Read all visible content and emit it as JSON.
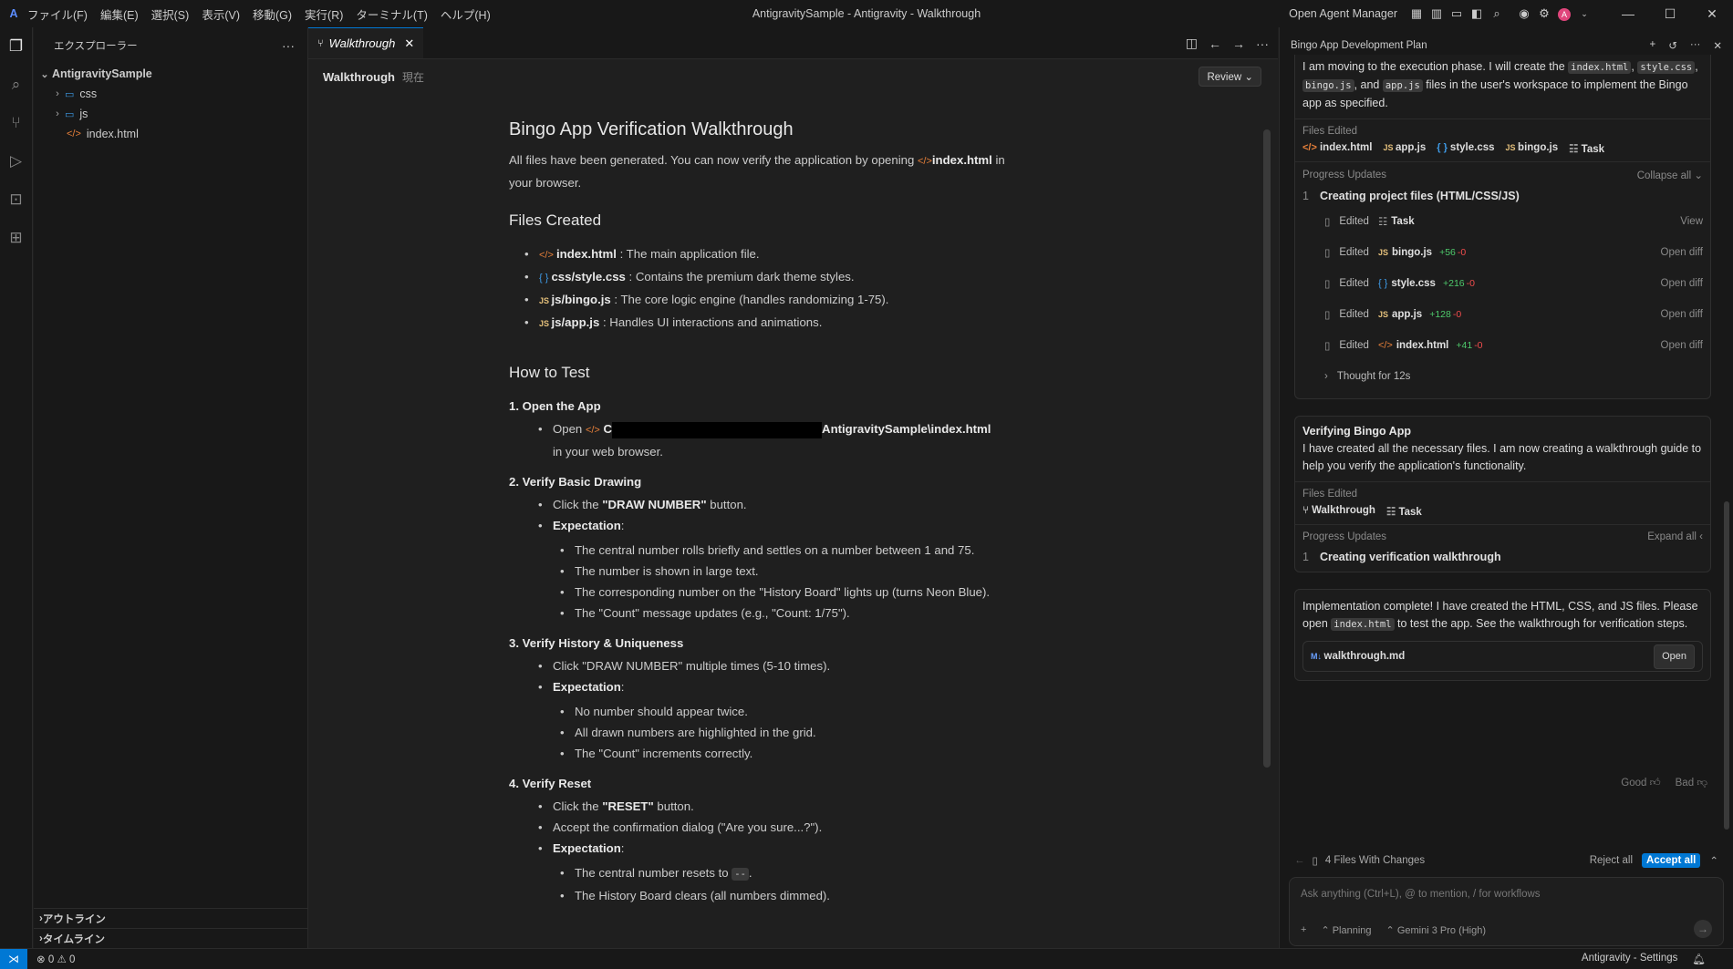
{
  "menu": [
    "ファイル(F)",
    "編集(E)",
    "選択(S)",
    "表示(V)",
    "移動(G)",
    "実行(R)",
    "ターミナル(T)",
    "ヘルプ(H)"
  ],
  "window_title": "AntigravitySample - Antigravity - Walkthrough",
  "open_agent_manager": "Open Agent Manager",
  "explorer": {
    "title": "エクスプローラー",
    "root": "AntigravitySample",
    "folders": [
      "css",
      "js"
    ],
    "file": "index.html",
    "outline": "アウトライン",
    "timeline": "タイムライン"
  },
  "tab": {
    "label": "Walkthrough"
  },
  "breadcrumb": {
    "name": "Walkthrough",
    "tag": "現在",
    "review": "Review"
  },
  "doc": {
    "title": "Bingo App Verification Walkthrough",
    "intro_a": "All files have been generated. You can now verify the application by opening",
    "intro_file": "index.html",
    "intro_b": "in",
    "intro_c": "your browser.",
    "files_heading": "Files Created",
    "files": [
      {
        "name": "index.html",
        "desc": ": The main application file."
      },
      {
        "name": "css/style.css",
        "desc": ": Contains the premium dark theme styles."
      },
      {
        "name": "js/bingo.js",
        "desc": ": The core logic engine (handles randomizing 1-75)."
      },
      {
        "name": "js/app.js",
        "desc": ": Handles UI interactions and animations."
      }
    ],
    "test_heading": "How to Test",
    "s1": "1. Open the App",
    "s1_open": "Open",
    "s1_c": "C",
    "s1_path": "AntigravitySample\\index.html",
    "s1_tail": "in your web browser.",
    "s2": "2. Verify Basic Drawing",
    "s2_click": "Click the",
    "s2_btn": "\"DRAW NUMBER\"",
    "s2_button": "button.",
    "expectation": "Expectation",
    "s2_exp": [
      "The central number rolls briefly and settles on a number between 1 and 75.",
      "The number is shown in large text.",
      "The corresponding number on the \"History Board\" lights up (turns Neon Blue).",
      "The \"Count\" message updates (e.g., \"Count: 1/75\")."
    ],
    "s3": "3. Verify History & Uniqueness",
    "s3_click": "Click \"DRAW NUMBER\" multiple times (5-10 times).",
    "s3_exp": [
      "No number should appear twice.",
      "All drawn numbers are highlighted in the grid.",
      "The \"Count\" increments correctly."
    ],
    "s4": "4. Verify Reset",
    "s4_click": "Click the",
    "s4_btn": "\"RESET\"",
    "s4_button": "button.",
    "s4_confirm": "Accept the confirmation dialog (\"Are you sure...?\").",
    "s4_exp_a": "The central number resets to",
    "s4_exp_code": "--",
    "s4_exp_b": "The History Board clears (all numbers dimmed)."
  },
  "agent": {
    "title": "Bingo App Development Plan",
    "top_msg_a": "I am moving to the execution phase. I will create the",
    "top_code1": "index.html",
    "top_code2": "style.css",
    "top_code3": "bingo.js",
    "top_code4": "app.js",
    "top_msg_b": "files in the user's workspace to implement the Bingo app as specified.",
    "files_edited": "Files Edited",
    "fe1": [
      "index.html",
      "app.js",
      "style.css",
      "bingo.js",
      "Task"
    ],
    "progress_updates": "Progress Updates",
    "collapse_all": "Collapse all",
    "step1": "Creating project files (HTML/CSS/JS)",
    "edited": "Edited",
    "edits": [
      {
        "file": "Task",
        "plus": "",
        "minus": "",
        "action": "View"
      },
      {
        "file": "bingo.js",
        "plus": "+56",
        "minus": "-0",
        "action": "Open diff"
      },
      {
        "file": "style.css",
        "plus": "+216",
        "minus": "-0",
        "action": "Open diff"
      },
      {
        "file": "app.js",
        "plus": "+128",
        "minus": "-0",
        "action": "Open diff"
      },
      {
        "file": "index.html",
        "plus": "+41",
        "minus": "-0",
        "action": "Open diff"
      }
    ],
    "thought": "Thought for 12s",
    "verify_title": "Verifying Bingo App",
    "verify_msg": "I have created all the necessary files. I am now creating a walkthrough guide to help you verify the application's functionality.",
    "fe2": [
      "Walkthrough",
      "Task"
    ],
    "expand_all": "Expand all",
    "step2": "Creating verification walkthrough",
    "final_a": "Implementation complete! I have created the HTML, CSS, and JS files. Please open",
    "final_code": "index.html",
    "final_b": "to test the app. See the walkthrough for verification steps.",
    "walk_file": "walkthrough.md",
    "open": "Open",
    "good": "Good",
    "bad": "Bad",
    "changes": "4 Files With Changes",
    "reject_all": "Reject all",
    "accept_all": "Accept all",
    "ask_placeholder": "Ask anything (Ctrl+L), @ to mention, / for workflows",
    "mode": "Planning",
    "model": "Gemini 3 Pro (High)"
  },
  "status": {
    "errors": "0",
    "warnings": "0",
    "settings": "Antigravity - Settings"
  }
}
